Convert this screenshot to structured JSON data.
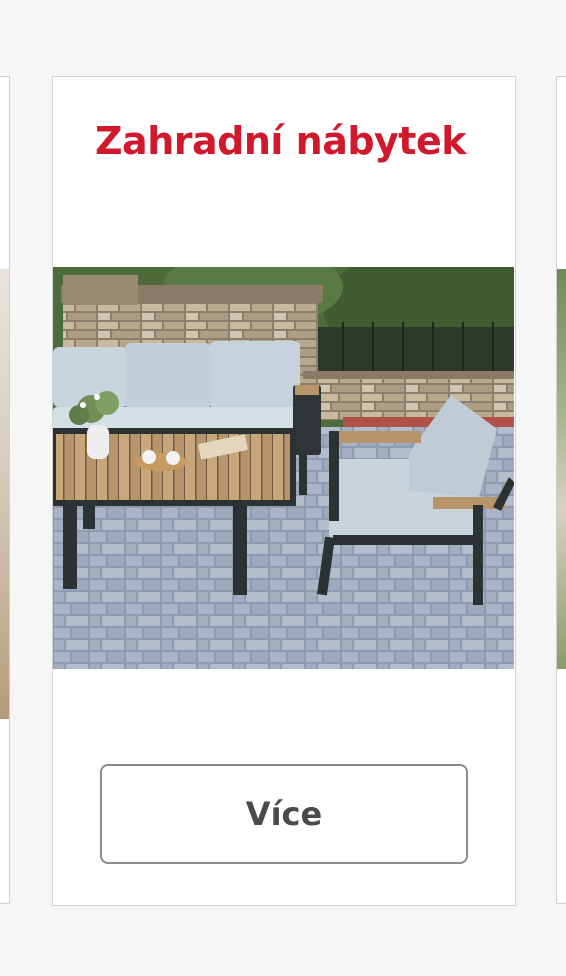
{
  "colors": {
    "title": "#d0192c",
    "button_text": "#4a4a4a",
    "button_border": "#8c8c8c"
  },
  "category_card": {
    "title": "Zahradní nábytek",
    "button_label": "Více",
    "image_icon": "garden-furniture-photo"
  }
}
